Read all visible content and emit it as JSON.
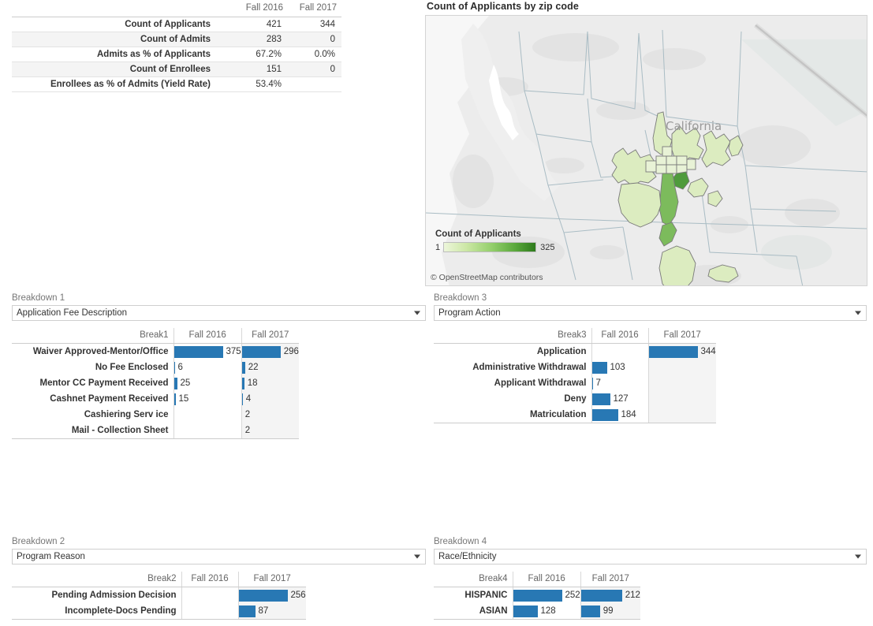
{
  "summary": {
    "columns": [
      "",
      "Fall 2016",
      "Fall 2017"
    ],
    "rows": [
      {
        "label": "Count of Applicants",
        "y1": "421",
        "y2": "344"
      },
      {
        "label": "Count of Admits",
        "y1": "283",
        "y2": "0"
      },
      {
        "label": "Admits as % of Applicants",
        "y1": "67.2%",
        "y2": "0.0%"
      },
      {
        "label": "Count of Enrollees",
        "y1": "151",
        "y2": "0"
      },
      {
        "label": "Enrollees as % of Admits (Yield Rate)",
        "y1": "53.4%",
        "y2": ""
      }
    ]
  },
  "map": {
    "title": "Count of Applicants by zip code",
    "region_label": "California",
    "legend": {
      "title": "Count of Applicants",
      "min": "1",
      "max": "325"
    },
    "attribution": "© OpenStreetMap contributors",
    "colors": {
      "low": "#edf6db",
      "high": "#2d7a1c"
    }
  },
  "accent_color": "#2878b4",
  "breakdowns": [
    {
      "id": "breakdown-1",
      "label": "Breakdown 1",
      "selected": "Application Fee Description",
      "columns": [
        "Break1",
        "Fall 2016",
        "Fall 2017"
      ],
      "max": 375,
      "rows": [
        {
          "cat": "Waiver Approved-Mentor/Office",
          "y1": "375",
          "y2": "296"
        },
        {
          "cat": "No Fee Enclosed",
          "y1": "6",
          "y2": "22"
        },
        {
          "cat": "Mentor CC Payment Received",
          "y1": "25",
          "y2": "18"
        },
        {
          "cat": "Cashnet Payment Received",
          "y1": "15",
          "y2": "4"
        },
        {
          "cat": "Cashiering Serv ice",
          "y1": "",
          "y2": "2"
        },
        {
          "cat": "Mail - Collection Sheet",
          "y1": "",
          "y2": "2"
        }
      ]
    },
    {
      "id": "breakdown-3",
      "label": "Breakdown 3",
      "selected": "Program Action",
      "columns": [
        "Break3",
        "Fall 2016",
        "Fall 2017"
      ],
      "max": 344,
      "rows": [
        {
          "cat": "Application",
          "y1": "",
          "y2": "344"
        },
        {
          "cat": "Administrative Withdrawal",
          "y1": "103",
          "y2": ""
        },
        {
          "cat": "Applicant Withdrawal",
          "y1": "7",
          "y2": ""
        },
        {
          "cat": "Deny",
          "y1": "127",
          "y2": ""
        },
        {
          "cat": "Matriculation",
          "y1": "184",
          "y2": ""
        }
      ]
    },
    {
      "id": "breakdown-2",
      "label": "Breakdown 2",
      "selected": "Program Reason",
      "columns": [
        "Break2",
        "Fall 2016",
        "Fall 2017"
      ],
      "max": 256,
      "rows": [
        {
          "cat": "Pending Admission Decision",
          "y1": "",
          "y2": "256"
        },
        {
          "cat": "Incomplete-Docs Pending",
          "y1": "",
          "y2": "87"
        }
      ]
    },
    {
      "id": "breakdown-4",
      "label": "Breakdown 4",
      "selected": "Race/Ethnicity",
      "columns": [
        "Break4",
        "Fall 2016",
        "Fall 2017"
      ],
      "max": 252,
      "rows": [
        {
          "cat": "HISPANIC",
          "y1": "252",
          "y2": "212"
        },
        {
          "cat": "ASIAN",
          "y1": "128",
          "y2": "99"
        }
      ]
    }
  ],
  "chart_data": [
    {
      "type": "bar",
      "title": "Application Fee Description",
      "categories": [
        "Waiver Approved-Mentor/Office",
        "No Fee Enclosed",
        "Mentor CC Payment Received",
        "Cashnet Payment Received",
        "Cashiering Serv ice",
        "Mail - Collection Sheet"
      ],
      "series": [
        {
          "name": "Fall 2016",
          "values": [
            375,
            6,
            25,
            15,
            null,
            null
          ]
        },
        {
          "name": "Fall 2017",
          "values": [
            296,
            22,
            18,
            4,
            2,
            2
          ]
        }
      ],
      "xlabel": "",
      "ylabel": "",
      "orientation": "horizontal"
    },
    {
      "type": "bar",
      "title": "Program Action",
      "categories": [
        "Application",
        "Administrative Withdrawal",
        "Applicant Withdrawal",
        "Deny",
        "Matriculation"
      ],
      "series": [
        {
          "name": "Fall 2016",
          "values": [
            null,
            103,
            7,
            127,
            184
          ]
        },
        {
          "name": "Fall 2017",
          "values": [
            344,
            null,
            null,
            null,
            null
          ]
        }
      ],
      "xlabel": "",
      "ylabel": "",
      "orientation": "horizontal"
    },
    {
      "type": "bar",
      "title": "Program Reason",
      "categories": [
        "Pending Admission Decision",
        "Incomplete-Docs Pending"
      ],
      "series": [
        {
          "name": "Fall 2016",
          "values": [
            null,
            null
          ]
        },
        {
          "name": "Fall 2017",
          "values": [
            256,
            87
          ]
        }
      ],
      "xlabel": "",
      "ylabel": "",
      "orientation": "horizontal"
    },
    {
      "type": "bar",
      "title": "Race/Ethnicity",
      "categories": [
        "HISPANIC",
        "ASIAN"
      ],
      "series": [
        {
          "name": "Fall 2016",
          "values": [
            252,
            128
          ]
        },
        {
          "name": "Fall 2017",
          "values": [
            212,
            99
          ]
        }
      ],
      "xlabel": "",
      "ylabel": "",
      "orientation": "horizontal"
    },
    {
      "type": "table",
      "title": "Admissions funnel summary",
      "categories": [
        "Count of Applicants",
        "Count of Admits",
        "Admits as % of Applicants",
        "Count of Enrollees",
        "Enrollees as % of Admits (Yield Rate)"
      ],
      "series": [
        {
          "name": "Fall 2016",
          "values": [
            421,
            283,
            67.2,
            151,
            53.4
          ]
        },
        {
          "name": "Fall 2017",
          "values": [
            344,
            0,
            0.0,
            0,
            null
          ]
        }
      ]
    },
    {
      "type": "heatmap",
      "title": "Count of Applicants by zip code",
      "xlabel": "",
      "ylabel": "",
      "legend": {
        "title": "Count of Applicants",
        "min": 1,
        "max": 325
      }
    }
  ]
}
